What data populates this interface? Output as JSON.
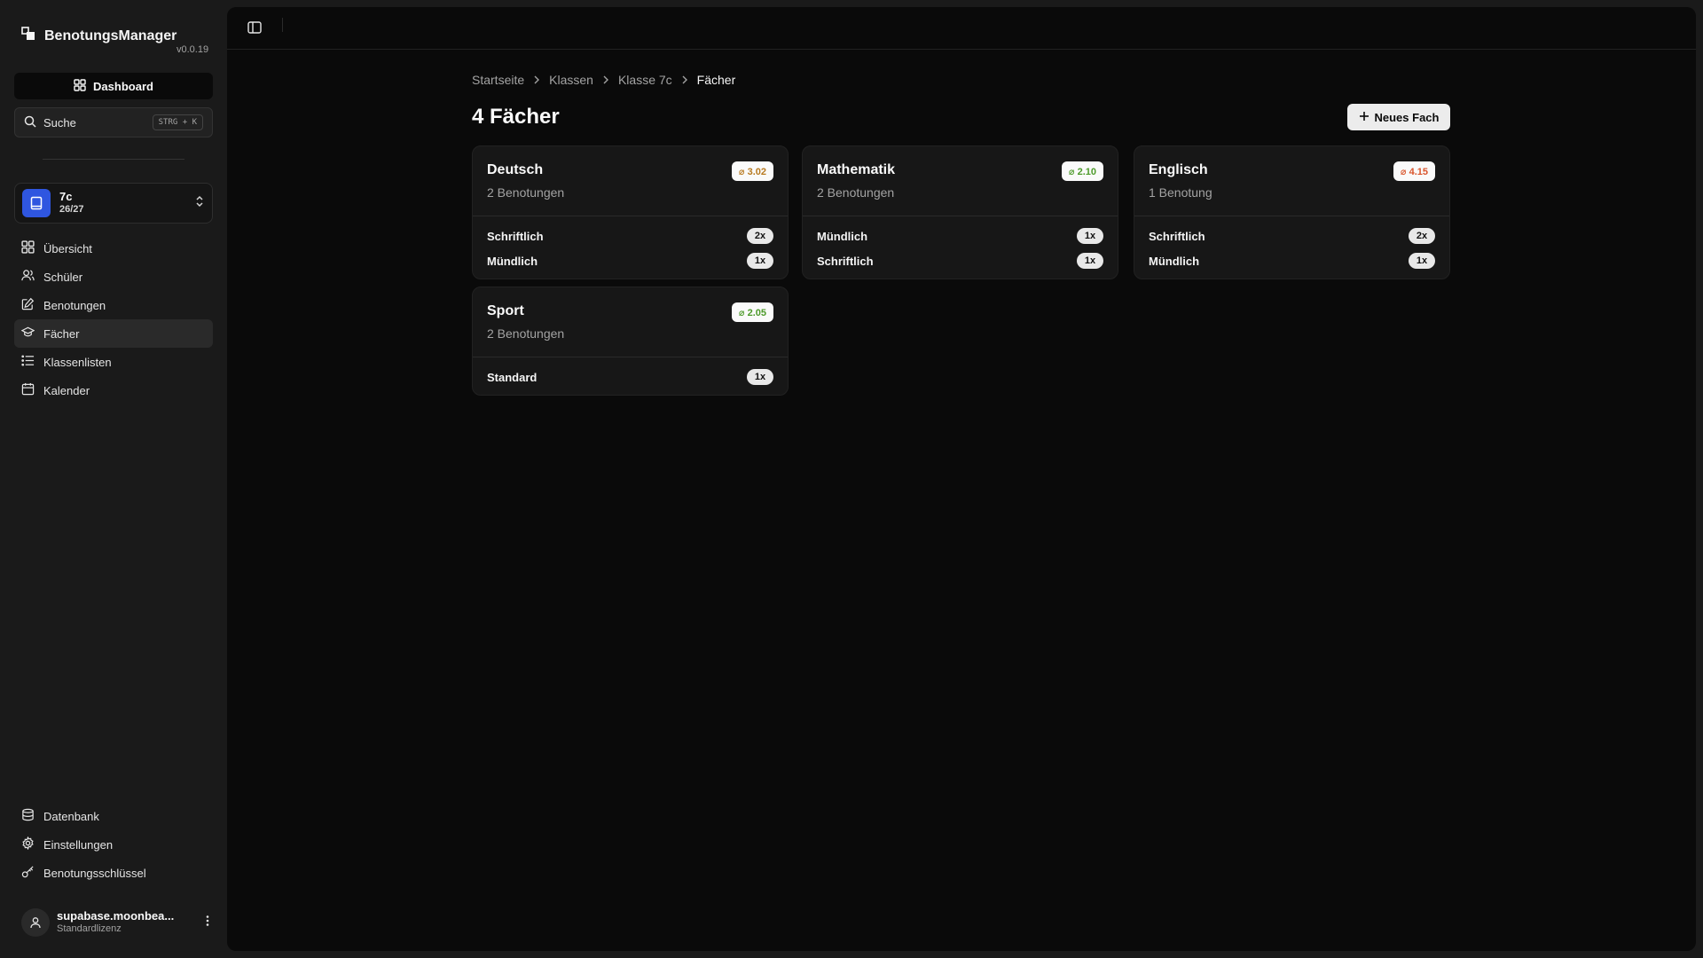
{
  "app": {
    "name": "BenotungsManager",
    "version": "v0.0.19"
  },
  "sidebar": {
    "dashboard_label": "Dashboard",
    "search": {
      "label": "Suche",
      "shortcut": "STRG + K"
    },
    "class_selector": {
      "name": "7c",
      "year": "26/27"
    },
    "items": [
      {
        "label": "Übersicht",
        "icon": "grid-icon"
      },
      {
        "label": "Schüler",
        "icon": "users-icon"
      },
      {
        "label": "Benotungen",
        "icon": "edit-icon"
      },
      {
        "label": "Fächer",
        "icon": "graduation-cap-icon",
        "active": true
      },
      {
        "label": "Klassenlisten",
        "icon": "list-icon"
      },
      {
        "label": "Kalender",
        "icon": "calendar-icon"
      }
    ],
    "bottom_items": [
      {
        "label": "Datenbank",
        "icon": "database-icon"
      },
      {
        "label": "Einstellungen",
        "icon": "gear-icon"
      },
      {
        "label": "Benotungsschlüssel",
        "icon": "key-icon"
      }
    ],
    "user": {
      "name": "supabase.moonbea...",
      "license": "Standardlizenz"
    }
  },
  "breadcrumb": [
    "Startseite",
    "Klassen",
    "Klasse 7c",
    "Fächer"
  ],
  "page": {
    "title": "4 Fächer",
    "new_button_label": "Neues Fach"
  },
  "subjects": [
    {
      "name": "Deutsch",
      "count_text": "2 Benotungen",
      "average": "⌀ 3.02",
      "average_color": "#b7791f",
      "rows": [
        {
          "label": "Schriftlich",
          "count": "2x"
        },
        {
          "label": "Mündlich",
          "count": "1x"
        }
      ]
    },
    {
      "name": "Mathematik",
      "count_text": "2 Benotungen",
      "average": "⌀ 2.10",
      "average_color": "#4d9a2a",
      "rows": [
        {
          "label": "Mündlich",
          "count": "1x"
        },
        {
          "label": "Schriftlich",
          "count": "1x"
        }
      ]
    },
    {
      "name": "Englisch",
      "count_text": "1 Benotung",
      "average": "⌀ 4.15",
      "average_color": "#d9542b",
      "rows": [
        {
          "label": "Schriftlich",
          "count": "2x"
        },
        {
          "label": "Mündlich",
          "count": "1x"
        }
      ]
    },
    {
      "name": "Sport",
      "count_text": "2 Benotungen",
      "average": "⌀ 2.05",
      "average_color": "#4d9a2a",
      "rows": [
        {
          "label": "Standard",
          "count": "1x"
        }
      ]
    }
  ]
}
